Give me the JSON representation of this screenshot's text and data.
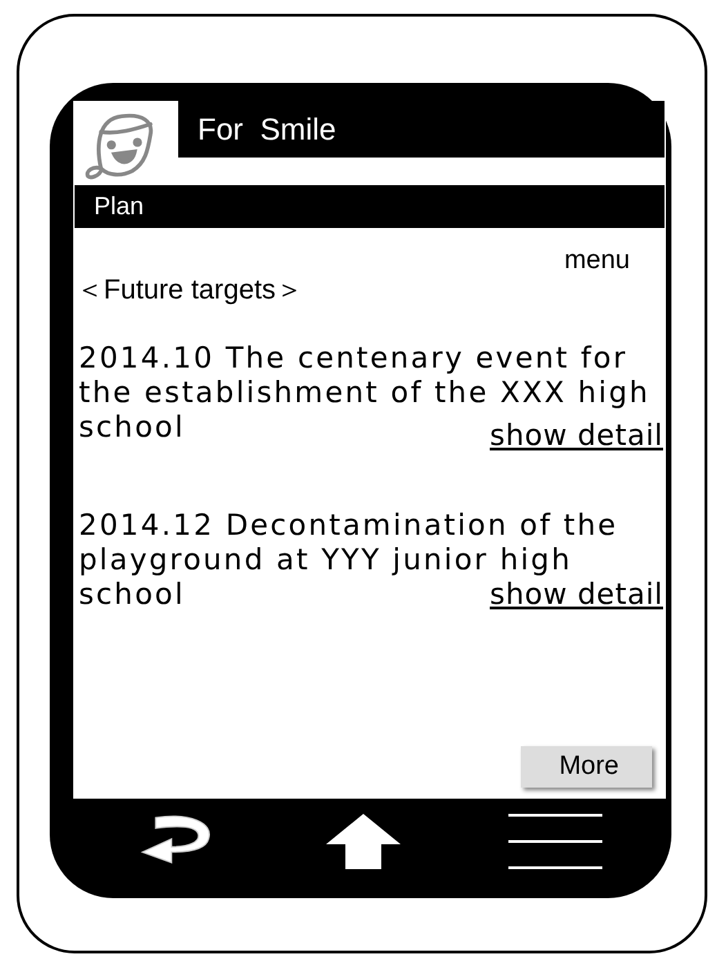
{
  "app": {
    "title": "For  Smile"
  },
  "section": "Plan",
  "menu": "menu",
  "heading": "＜Future targets＞",
  "targets": [
    {
      "text": "2014.10 The centenary event for the establishment of the XXX high school",
      "link": "show detail"
    },
    {
      "text": "2014.12 Decontamination of the playground at YYY junior high school",
      "link": "show detail"
    }
  ],
  "more_button": "More",
  "nav": [
    {
      "kind": "back"
    },
    {
      "kind": "home"
    },
    {
      "kind": "menu"
    }
  ]
}
